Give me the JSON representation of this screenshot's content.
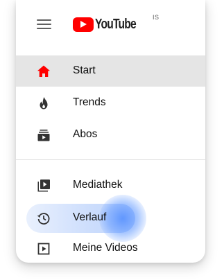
{
  "header": {
    "logo_text": "YouTube",
    "country_code": "IS"
  },
  "nav": {
    "items": [
      {
        "label": "Start",
        "icon": "home-icon",
        "active": true
      },
      {
        "label": "Trends",
        "icon": "flame-icon",
        "active": false
      },
      {
        "label": "Abos",
        "icon": "subscriptions-icon",
        "active": false
      },
      {
        "label": "Mediathek",
        "icon": "library-icon",
        "active": false
      },
      {
        "label": "Verlauf",
        "icon": "history-icon",
        "active": false,
        "hovered": true
      },
      {
        "label": "Meine Videos",
        "icon": "my-videos-icon",
        "active": false
      }
    ]
  },
  "colors": {
    "brand_red": "#ff0000",
    "active_bg": "#e5e5e5",
    "icon_gray": "#606060",
    "text": "#0f0f0f",
    "hover_blue": "#5a8cff"
  }
}
